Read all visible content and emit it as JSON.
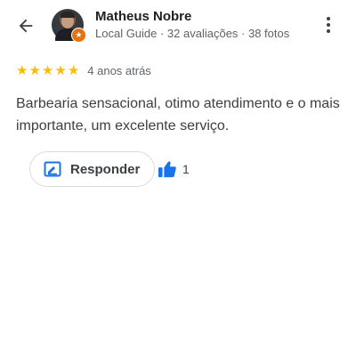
{
  "header": {
    "back_icon": "arrow-back-icon",
    "reviewer_name": "Matheus Nobre",
    "reviewer_meta": "Local Guide · 32 avaliações · 38 fotos",
    "badge_icon": "local-guide-star-icon",
    "more_icon": "more-vert-icon"
  },
  "review": {
    "stars": 5,
    "star_color": "#fbbc04",
    "date": "4 anos atrás",
    "text": "Barbearia sensacional, otimo atendimento e o mais importante, um excelente serviço."
  },
  "actions": {
    "reply_label": "Responder",
    "reply_icon": "reply-edit-icon",
    "like_icon": "thumb-up-icon",
    "like_count": "1",
    "accent_color": "#1a73e8"
  }
}
